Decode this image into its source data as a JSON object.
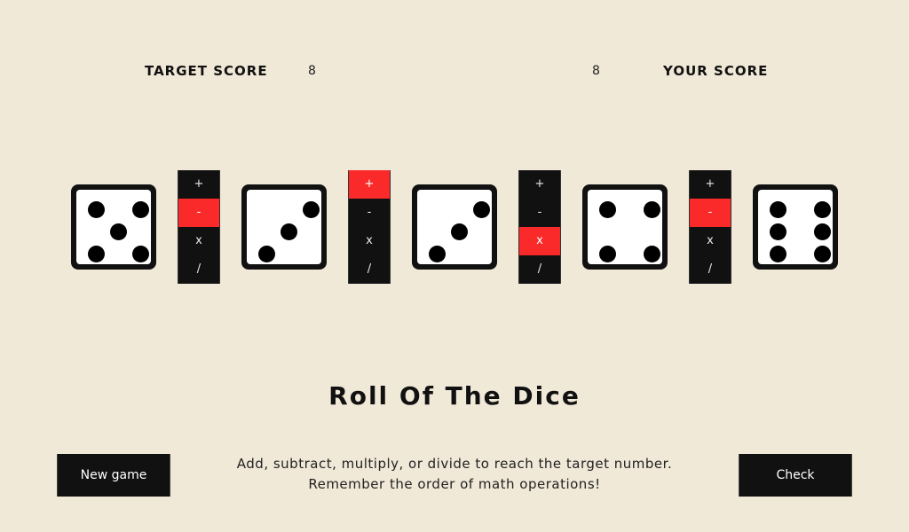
{
  "scores": {
    "target_label": "TARGET SCORE",
    "target_value": "8",
    "your_value": "8",
    "your_label": "YOUR SCORE"
  },
  "dice": [
    5,
    3,
    3,
    4,
    6
  ],
  "operators": [
    {
      "options": [
        "+",
        "-",
        "x",
        "/"
      ],
      "selected": "-"
    },
    {
      "options": [
        "+",
        "-",
        "x",
        "/"
      ],
      "selected": "+"
    },
    {
      "options": [
        "+",
        "-",
        "x",
        "/"
      ],
      "selected": "x"
    },
    {
      "options": [
        "+",
        "-",
        "x",
        "/"
      ],
      "selected": "-"
    }
  ],
  "title": "Roll Of The Dice",
  "buttons": {
    "new_game": "New game",
    "check": "Check"
  },
  "instructions": {
    "line1": "Add, subtract, multiply, or divide to reach the target number.",
    "line2": "Remember the order of math operations!"
  },
  "colors": {
    "background": "#f1e9d8",
    "accent": "#fa2a2a",
    "dark": "#111111"
  }
}
